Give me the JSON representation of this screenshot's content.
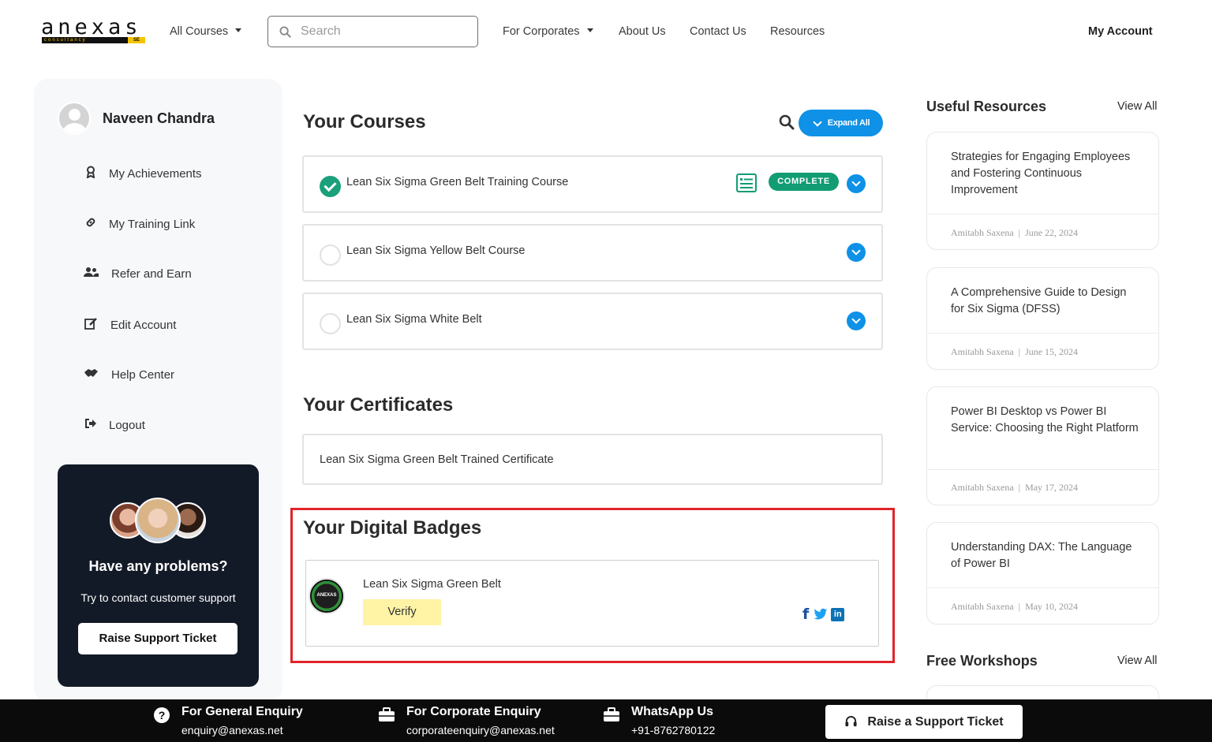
{
  "header": {
    "logo": {
      "word": "anexas",
      "tagline": "consultancy",
      "suffix": "SE"
    },
    "all_courses": "All Courses",
    "search_placeholder": "Search",
    "for_corporates": "For Corporates",
    "about": "About Us",
    "contact": "Contact Us",
    "resources": "Resources",
    "account": "My Account"
  },
  "sidebar": {
    "user_name": "Naveen Chandra",
    "items": [
      {
        "label": "My Achievements",
        "icon": "award-icon"
      },
      {
        "label": "My Training Link",
        "icon": "link-icon"
      },
      {
        "label": "Refer and Earn",
        "icon": "users-icon"
      },
      {
        "label": "Edit Account",
        "icon": "edit-icon"
      },
      {
        "label": "Help Center",
        "icon": "handshake-icon"
      },
      {
        "label": "Logout",
        "icon": "logout-icon"
      }
    ],
    "support": {
      "title": "Have any problems?",
      "subtitle": "Try to contact customer support",
      "button": "Raise Support Ticket"
    }
  },
  "courses": {
    "title": "Your Courses",
    "expand_label": "Expand All",
    "items": [
      {
        "title": "Lean Six Sigma Green Belt Training Course",
        "status": "COMPLETE",
        "completed": true
      },
      {
        "title": "Lean Six Sigma Yellow Belt Course",
        "completed": false
      },
      {
        "title": "Lean Six Sigma White Belt",
        "completed": false
      }
    ]
  },
  "certificates": {
    "title": "Your Certificates",
    "items": [
      "Lean Six Sigma Green Belt Trained Certificate"
    ]
  },
  "badges": {
    "title": "Your Digital Badges",
    "items": [
      {
        "name": "Lean Six Sigma Green Belt",
        "verify_label": "Verify",
        "seal_text": "ANEXAS"
      }
    ],
    "share_icons": [
      "facebook-icon",
      "twitter-icon",
      "linkedin-icon"
    ],
    "highlight_color": "#e0242a"
  },
  "resources": {
    "title": "Useful Resources",
    "view_all": "View All",
    "items": [
      {
        "title": "Strategies for Engaging Employees and Fostering Continuous Improvement",
        "author": "Amitabh Saxena",
        "date": "June 22, 2024"
      },
      {
        "title": "A Comprehensive Guide to Design for Six Sigma (DFSS)",
        "author": "Amitabh Saxena",
        "date": "June 15, 2024"
      },
      {
        "title": "Power BI Desktop vs Power BI Service: Choosing the Right Platform",
        "author": "Amitabh Saxena",
        "date": "May 17, 2024"
      },
      {
        "title": "Understanding DAX: The Language of Power BI",
        "author": "Amitabh Saxena",
        "date": "May 10, 2024"
      }
    ]
  },
  "workshops": {
    "title": "Free Workshops",
    "view_all": "View All"
  },
  "footer": {
    "general": {
      "title": "For General Enquiry",
      "value": "enquiry@anexas.net"
    },
    "corporate": {
      "title": "For Corporate Enquiry",
      "value": "corporateenquiry@anexas.net"
    },
    "whatsapp": {
      "title": "WhatsApp Us",
      "value": "+91-8762780122"
    },
    "ticket_button": "Raise a Support Ticket"
  },
  "colors": {
    "accent_blue": "#0e91e6",
    "complete_green": "#119c73",
    "verify_yellow": "#fff3a6"
  }
}
